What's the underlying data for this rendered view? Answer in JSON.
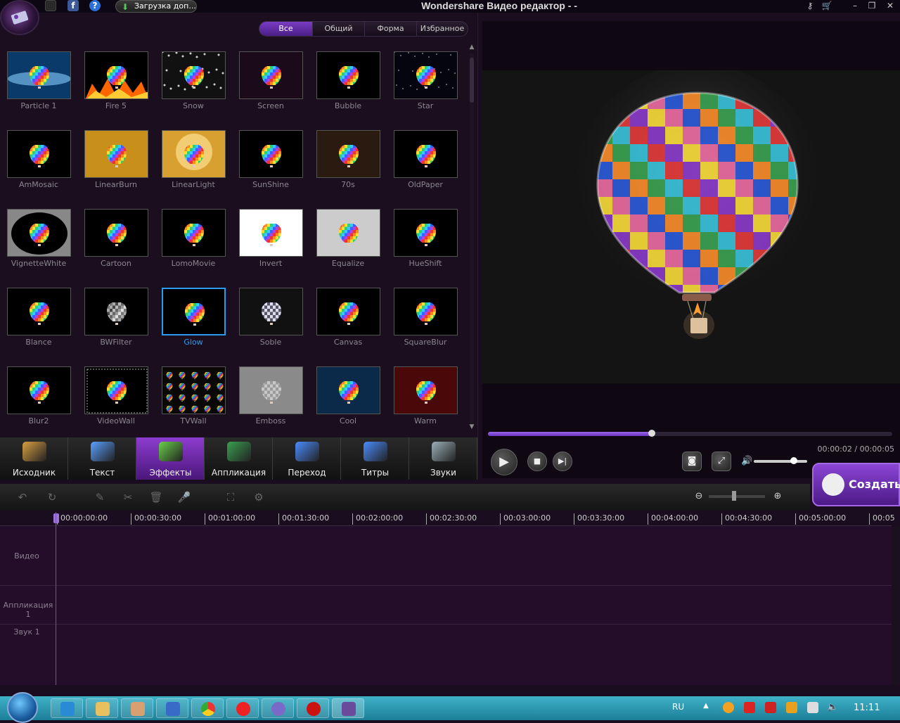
{
  "titlebar": {
    "app_title": "Wondershare Видео редактор - -",
    "download_label": "Загрузка доп..."
  },
  "filter_tabs": [
    {
      "label": "Все",
      "active": true
    },
    {
      "label": "Общий",
      "active": false
    },
    {
      "label": "Форма",
      "active": false
    },
    {
      "label": "Избранное",
      "active": false
    }
  ],
  "effects": [
    {
      "name": "Particle 1",
      "style": "particle"
    },
    {
      "name": "Fire 5",
      "style": "fire"
    },
    {
      "name": "Snow",
      "style": "snow"
    },
    {
      "name": "Screen",
      "style": "screen"
    },
    {
      "name": "Bubble",
      "style": "plain"
    },
    {
      "name": "Star",
      "style": "star"
    },
    {
      "name": "AmMosaic",
      "style": "plain"
    },
    {
      "name": "LinearBurn",
      "style": "burn"
    },
    {
      "name": "LinearLight",
      "style": "light"
    },
    {
      "name": "SunShine",
      "style": "plain"
    },
    {
      "name": "70s",
      "style": "seventies"
    },
    {
      "name": "OldPaper",
      "style": "plain"
    },
    {
      "name": "VignetteWhite",
      "style": "vignette"
    },
    {
      "name": "Cartoon",
      "style": "plain"
    },
    {
      "name": "LomoMovie",
      "style": "plain"
    },
    {
      "name": "Invert",
      "style": "invert"
    },
    {
      "name": "Equalize",
      "style": "equalize"
    },
    {
      "name": "HueShift",
      "style": "plain"
    },
    {
      "name": "Blance",
      "style": "plain"
    },
    {
      "name": "BWFilter",
      "style": "bw"
    },
    {
      "name": "Glow",
      "style": "plain",
      "selected": true
    },
    {
      "name": "Soble",
      "style": "soble"
    },
    {
      "name": "Canvas",
      "style": "plain"
    },
    {
      "name": "SquareBlur",
      "style": "plain"
    },
    {
      "name": "Blur2",
      "style": "plain"
    },
    {
      "name": "VideoWall",
      "style": "videowall"
    },
    {
      "name": "TVWall",
      "style": "tvwall"
    },
    {
      "name": "Emboss",
      "style": "emboss"
    },
    {
      "name": "Cool",
      "style": "cool"
    },
    {
      "name": "Warm",
      "style": "warm"
    }
  ],
  "main_tabs": [
    {
      "label": "Исходник",
      "icon": "film-music-icon",
      "active": false
    },
    {
      "label": "Текст",
      "icon": "text-feather-icon",
      "active": false
    },
    {
      "label": "Эффекты",
      "icon": "effects-icon",
      "active": true
    },
    {
      "label": "Аппликация",
      "icon": "overlay-icon",
      "active": false
    },
    {
      "label": "Переход",
      "icon": "transition-icon",
      "active": false
    },
    {
      "label": "Титры",
      "icon": "clapper-icon",
      "active": false
    },
    {
      "label": "Звуки",
      "icon": "microphone-icon",
      "active": false
    }
  ],
  "preview": {
    "timecode": "00:00:02 / 00:00:05",
    "progress": 0.405,
    "volume": 0.75
  },
  "create_label": "Создать",
  "timeline": {
    "ticks": [
      "00:00:00:00",
      "00:00:30:00",
      "00:01:00:00",
      "00:01:30:00",
      "00:02:00:00",
      "00:02:30:00",
      "00:03:00:00",
      "00:03:30:00",
      "00:04:00:00",
      "00:04:30:00",
      "00:05:00:00",
      "00:05"
    ],
    "tracks": [
      {
        "label": "Видео"
      },
      {
        "label": "Аппликация 1"
      },
      {
        "label": "Звук 1"
      }
    ],
    "zoom": 0.45
  },
  "taskbar": {
    "lang": "RU",
    "clock": "11:11"
  },
  "colors": {
    "accent": "#7a3cc2",
    "selection": "#2a9cf0",
    "playhead": "#dd3333"
  }
}
